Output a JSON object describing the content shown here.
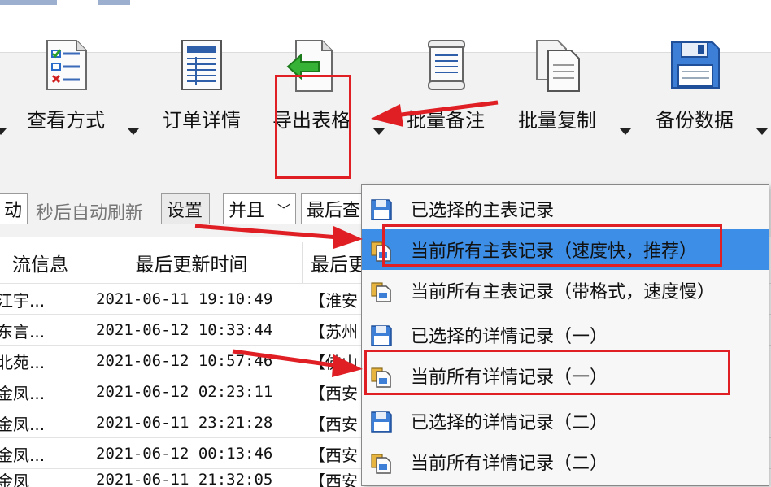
{
  "toolbar": {
    "buttons": [
      {
        "label": "查看方式",
        "icon": "view-mode-icon"
      },
      {
        "label": "订单详情",
        "icon": "order-details-icon"
      },
      {
        "label": "导出表格",
        "icon": "export-table-icon"
      },
      {
        "label": "批量备注",
        "icon": "batch-note-icon"
      },
      {
        "label": "批量复制",
        "icon": "batch-copy-icon"
      },
      {
        "label": "备份数据",
        "icon": "backup-data-icon"
      }
    ]
  },
  "filter": {
    "auto_left": "动",
    "refresh_text": "秒后自动刷新",
    "settings_label": "设置",
    "logic_value": "并且",
    "field_value": "最后查"
  },
  "table": {
    "headers": [
      "流信息",
      "最后更新时间",
      "最后更"
    ],
    "rows": [
      {
        "info": "江宇...",
        "time": "2021-06-11 19:10:49",
        "last": "【淮安"
      },
      {
        "info": "东言...",
        "time": "2021-06-12 10:33:44",
        "last": "【苏州"
      },
      {
        "info": "北苑...",
        "time": "2021-06-12 10:57:46",
        "last": "【佛山"
      },
      {
        "info": "金凤...",
        "time": "2021-06-12 02:23:11",
        "last": "【西安"
      },
      {
        "info": "金凤...",
        "time": "2021-06-11 23:21:28",
        "last": "【西安"
      },
      {
        "info": "金凤...",
        "time": "2021-06-12 00:13:46",
        "last": "【西安"
      },
      {
        "info": "金凤",
        "time": "2021-06-11 21:32:05",
        "last": "【西安"
      }
    ]
  },
  "export_menu": {
    "items": [
      {
        "label": "已选择的主表记录",
        "icon": "save-disk-icon",
        "selected": false
      },
      {
        "label": "当前所有主表记录（速度快，推荐）",
        "icon": "document-copy-icon",
        "selected": true
      },
      {
        "label": "当前所有主表记录（带格式，速度慢）",
        "icon": "document-copy-icon",
        "selected": false
      },
      {
        "label": "已选择的详情记录（一）",
        "icon": "save-disk-icon",
        "selected": false
      },
      {
        "label": "当前所有详情记录（一）",
        "icon": "document-copy-icon",
        "selected": false
      },
      {
        "label": "已选择的详情记录（二）",
        "icon": "save-disk-icon",
        "selected": false
      },
      {
        "label": "当前所有详情记录（二）",
        "icon": "document-copy-icon",
        "selected": false
      }
    ]
  },
  "colors": {
    "highlight": "#3d8ee6",
    "annotation_red": "#e01f25",
    "toolbar_bg": "#f2f2f2"
  }
}
